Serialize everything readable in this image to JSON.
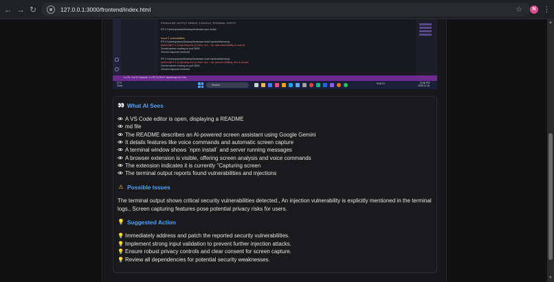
{
  "browser": {
    "url": "127.0.0.1:3000/frontend/index.html",
    "profile_initial": "N"
  },
  "screenshot": {
    "terminal_tabs": "PROBLEMS   OUTPUT   DEBUG CONSOLE   TERMINAL   PORTS",
    "terminal_lines": [
      "PS C:\\Users\\pranav\\Desktop\\lmoimaxe npm install",
      "found 0 vulnerabilities",
      "PS C:\\Users\\pranav\\Desktop\\lmoimaxe node backend/server.js",
      "[dotenv@17.2.1] injecting env (1) from .env -- tip: add observability to secrets",
      "Gemini server running on port 3000",
      "Gemini response received",
      "PS C:\\Users\\pranav\\Desktop\\lmoimaxe node backend/server.js",
      "[dotenv@17.2.1] injecting env (1) from .env -- tip: prevent building .env in docker",
      "Gemini server running on port 3000",
      "Gemini response received"
    ],
    "status_text": "Ln 22, Col 12   Spaces: 4   UTF-8   CRLF   JavaScript   Go Live",
    "weather_temp": "27°C",
    "weather_desc": "Clear",
    "search_label": "Search",
    "tray_text": "ENG IN",
    "clock_time": "11:58 PM",
    "clock_date": "2025-11-16"
  },
  "sections": {
    "what_ai_sees": {
      "icon": "👀",
      "title": "What AI Sees",
      "items": [
        "A VS Code editor is open, displaying a README",
        "md file",
        "The README describes an AI-powered screen assistant using Google Gemini",
        "It details features like voice commands and automatic screen capture",
        "A terminal window shows `npm install` and server running messages",
        "A browser extension is visible, offering screen analysis and voice commands",
        "The extension indicates it is currently \"Capturing screen",
        "The terminal output reports found vulnerabilities and injections"
      ]
    },
    "possible_issues": {
      "icon": "⚠",
      "title": "Possible Issues",
      "text": "The terminal output shows critical security vulnerabilities detected., An injection vulnerability is explicitly mentioned in the terminal logs., Screen capturing features pose potential privacy risks for users."
    },
    "suggested_action": {
      "icon": "💡",
      "title": "Suggested Action",
      "items": [
        "Immediately address and patch the reported security vulnerabilities.",
        "Implement strong input validation to prevent further injection attacks.",
        "Ensure robust privacy controls and clear consent for screen capture.",
        "Review all dependencies for potential security weaknesses."
      ]
    }
  }
}
